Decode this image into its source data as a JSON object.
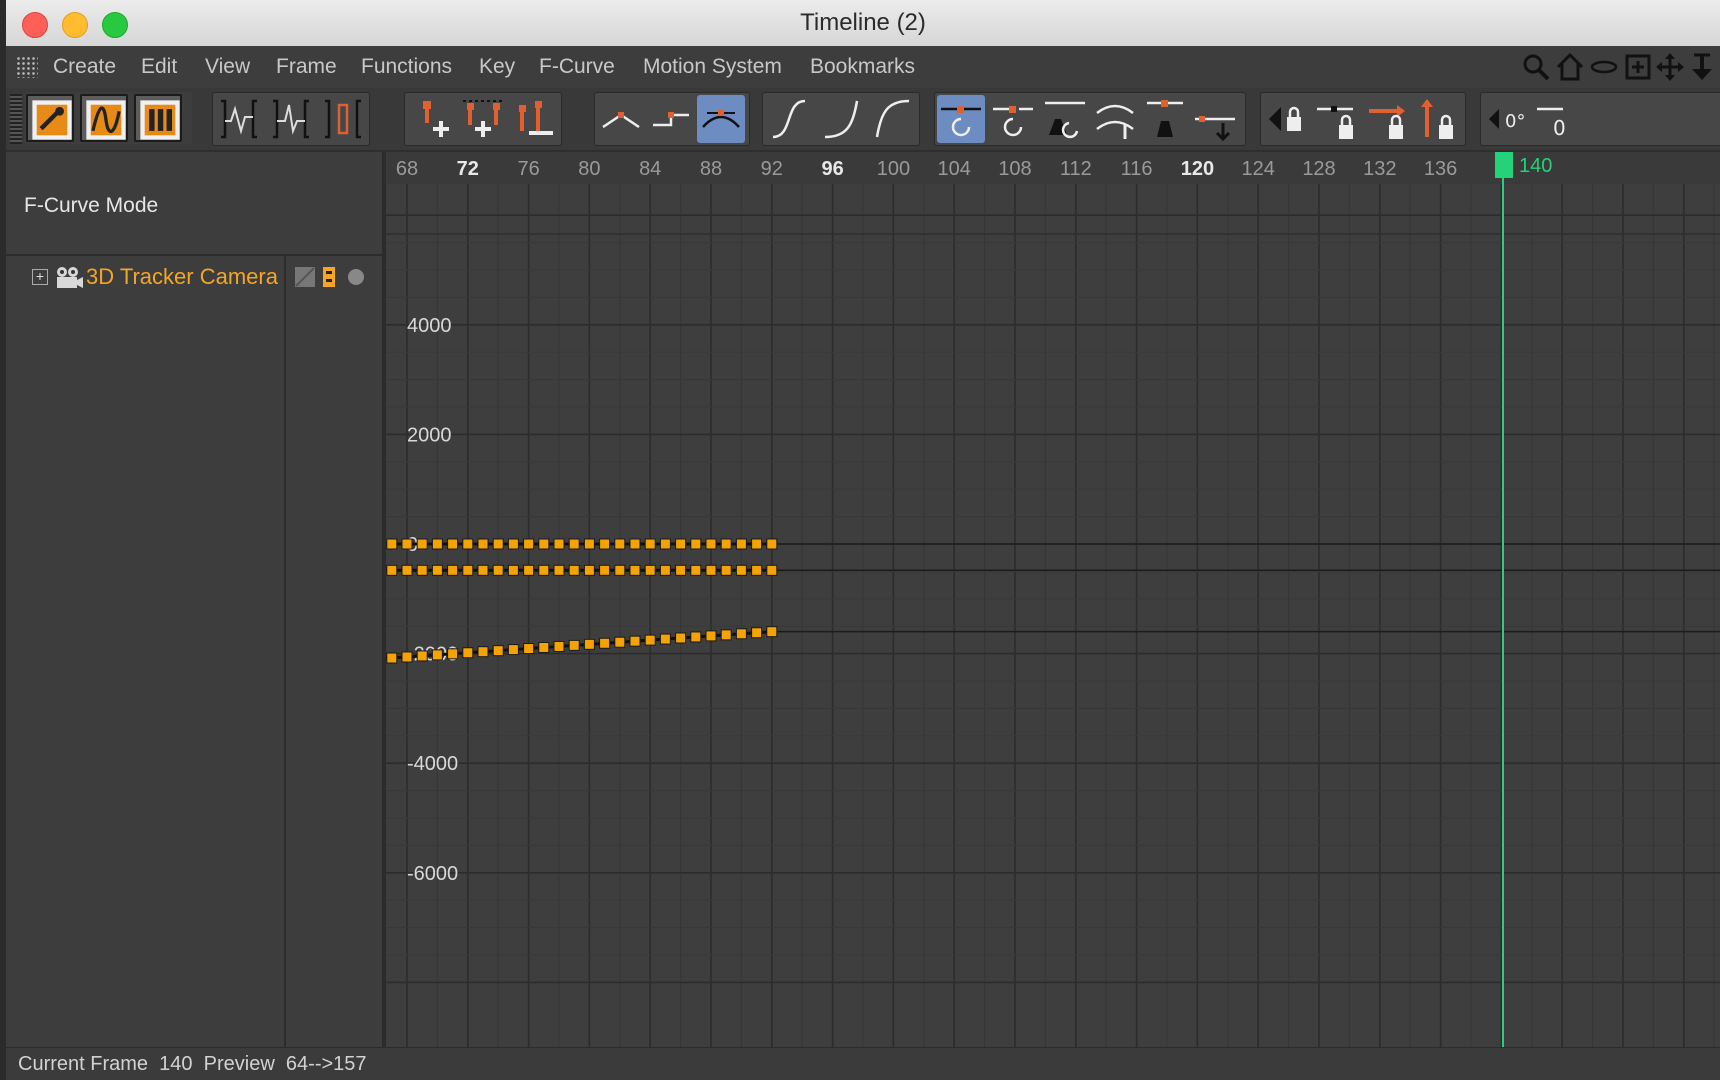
{
  "window": {
    "title": "Timeline (2)"
  },
  "menu": [
    "Create",
    "Edit",
    "View",
    "Frame",
    "Functions",
    "Key",
    "F-Curve",
    "Motion System",
    "Bookmarks"
  ],
  "top_right_icons": [
    "search-icon",
    "home-icon",
    "frame-all-icon",
    "fit-icon",
    "move-icon",
    "arrow-down-icon"
  ],
  "toolbar": {
    "groups": [
      [
        "key-mode-icon",
        "fcurve-mode-icon",
        "dopesheet-mode-icon"
      ],
      [
        "show-curve-icon",
        "zero-curve-icon",
        "bracket-icon"
      ],
      [
        "add-key-icon",
        "add-keys-icon",
        "delete-key-icon"
      ],
      [
        "interp-linear-icon",
        "interp-step-icon",
        "interp-spline-icon"
      ],
      [
        "ease-in-out-icon",
        "ease-in-icon",
        "ease-out-icon"
      ],
      [
        "tangent-auto-icon",
        "tangent-break-icon",
        "tangent-weight-icon",
        "tangent-zero-icon",
        "tangent-flat-icon",
        "tangent-down-icon"
      ],
      [
        "lock-time-icon",
        "lock-value-icon",
        "lock-h-icon",
        "lock-v-icon"
      ],
      [
        "rotate-zero-icon",
        "more-icon"
      ]
    ],
    "active": [
      "interp-spline-icon",
      "tangent-auto-icon"
    ]
  },
  "left_panel": {
    "mode_label": "F-Curve Mode",
    "track": {
      "expander": "+",
      "name": "3D Tracker Camera"
    }
  },
  "ruler": {
    "labels": [
      "68",
      "72",
      "76",
      "80",
      "84",
      "88",
      "92",
      "96",
      "100",
      "104",
      "108",
      "112",
      "116",
      "120",
      "124",
      "128",
      "132",
      "136"
    ],
    "bold": [
      "72",
      "96",
      "120"
    ],
    "current_frame_label": "140"
  },
  "value_axis": [
    "4000",
    "2000",
    "0",
    "-2000",
    "-4000",
    "-6000"
  ],
  "curves": {
    "key_color": "#f5a300",
    "frame_start": 66,
    "frame_end": 92,
    "series": [
      {
        "values_start": 0,
        "values_end": 0
      },
      {
        "values_start": -480,
        "values_end": -480
      },
      {
        "values_start": -2100,
        "values_end": -1600
      }
    ]
  },
  "status": {
    "current_frame_label": "Current Frame",
    "current_frame": "140",
    "preview_label": "Preview",
    "preview_range": "64-->157"
  },
  "colors": {
    "accent": "#f4a624",
    "active_button": "#6d8cc2",
    "playhead": "#25d27a"
  }
}
